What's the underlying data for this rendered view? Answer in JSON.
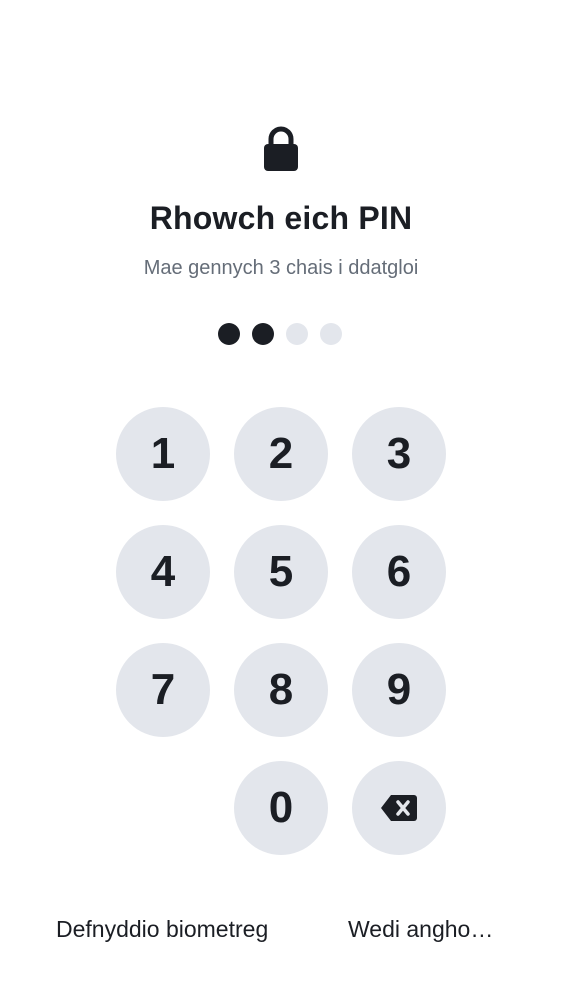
{
  "header": {
    "lock_icon": "lock-icon",
    "title": "Rhowch eich PIN",
    "subtitle": "Mae gennych 3 chais i ddatgloi"
  },
  "pin": {
    "length": 4,
    "entered": 2
  },
  "keypad": {
    "keys": [
      "1",
      "2",
      "3",
      "4",
      "5",
      "6",
      "7",
      "8",
      "9",
      "0"
    ],
    "backspace_icon": "backspace-icon"
  },
  "footer": {
    "biometric_label": "Defnyddio biometreg",
    "forgot_label": "Wedi angho…"
  },
  "colors": {
    "key_background": "#e3e6ec",
    "text_primary": "#1b1e24",
    "text_secondary": "#656d78",
    "dot_empty": "#e3e6ec",
    "dot_filled": "#1b1e24"
  }
}
